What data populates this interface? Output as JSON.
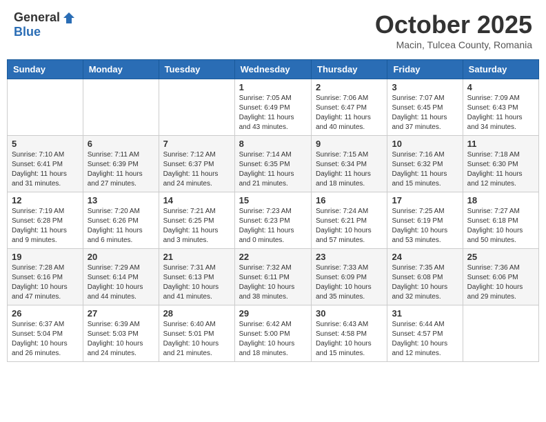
{
  "header": {
    "logo_general": "General",
    "logo_blue": "Blue",
    "month_title": "October 2025",
    "subtitle": "Macin, Tulcea County, Romania"
  },
  "weekdays": [
    "Sunday",
    "Monday",
    "Tuesday",
    "Wednesday",
    "Thursday",
    "Friday",
    "Saturday"
  ],
  "weeks": [
    [
      {
        "day": "",
        "info": ""
      },
      {
        "day": "",
        "info": ""
      },
      {
        "day": "",
        "info": ""
      },
      {
        "day": "1",
        "info": "Sunrise: 7:05 AM\nSunset: 6:49 PM\nDaylight: 11 hours\nand 43 minutes."
      },
      {
        "day": "2",
        "info": "Sunrise: 7:06 AM\nSunset: 6:47 PM\nDaylight: 11 hours\nand 40 minutes."
      },
      {
        "day": "3",
        "info": "Sunrise: 7:07 AM\nSunset: 6:45 PM\nDaylight: 11 hours\nand 37 minutes."
      },
      {
        "day": "4",
        "info": "Sunrise: 7:09 AM\nSunset: 6:43 PM\nDaylight: 11 hours\nand 34 minutes."
      }
    ],
    [
      {
        "day": "5",
        "info": "Sunrise: 7:10 AM\nSunset: 6:41 PM\nDaylight: 11 hours\nand 31 minutes."
      },
      {
        "day": "6",
        "info": "Sunrise: 7:11 AM\nSunset: 6:39 PM\nDaylight: 11 hours\nand 27 minutes."
      },
      {
        "day": "7",
        "info": "Sunrise: 7:12 AM\nSunset: 6:37 PM\nDaylight: 11 hours\nand 24 minutes."
      },
      {
        "day": "8",
        "info": "Sunrise: 7:14 AM\nSunset: 6:35 PM\nDaylight: 11 hours\nand 21 minutes."
      },
      {
        "day": "9",
        "info": "Sunrise: 7:15 AM\nSunset: 6:34 PM\nDaylight: 11 hours\nand 18 minutes."
      },
      {
        "day": "10",
        "info": "Sunrise: 7:16 AM\nSunset: 6:32 PM\nDaylight: 11 hours\nand 15 minutes."
      },
      {
        "day": "11",
        "info": "Sunrise: 7:18 AM\nSunset: 6:30 PM\nDaylight: 11 hours\nand 12 minutes."
      }
    ],
    [
      {
        "day": "12",
        "info": "Sunrise: 7:19 AM\nSunset: 6:28 PM\nDaylight: 11 hours\nand 9 minutes."
      },
      {
        "day": "13",
        "info": "Sunrise: 7:20 AM\nSunset: 6:26 PM\nDaylight: 11 hours\nand 6 minutes."
      },
      {
        "day": "14",
        "info": "Sunrise: 7:21 AM\nSunset: 6:25 PM\nDaylight: 11 hours\nand 3 minutes."
      },
      {
        "day": "15",
        "info": "Sunrise: 7:23 AM\nSunset: 6:23 PM\nDaylight: 11 hours\nand 0 minutes."
      },
      {
        "day": "16",
        "info": "Sunrise: 7:24 AM\nSunset: 6:21 PM\nDaylight: 10 hours\nand 57 minutes."
      },
      {
        "day": "17",
        "info": "Sunrise: 7:25 AM\nSunset: 6:19 PM\nDaylight: 10 hours\nand 53 minutes."
      },
      {
        "day": "18",
        "info": "Sunrise: 7:27 AM\nSunset: 6:18 PM\nDaylight: 10 hours\nand 50 minutes."
      }
    ],
    [
      {
        "day": "19",
        "info": "Sunrise: 7:28 AM\nSunset: 6:16 PM\nDaylight: 10 hours\nand 47 minutes."
      },
      {
        "day": "20",
        "info": "Sunrise: 7:29 AM\nSunset: 6:14 PM\nDaylight: 10 hours\nand 44 minutes."
      },
      {
        "day": "21",
        "info": "Sunrise: 7:31 AM\nSunset: 6:13 PM\nDaylight: 10 hours\nand 41 minutes."
      },
      {
        "day": "22",
        "info": "Sunrise: 7:32 AM\nSunset: 6:11 PM\nDaylight: 10 hours\nand 38 minutes."
      },
      {
        "day": "23",
        "info": "Sunrise: 7:33 AM\nSunset: 6:09 PM\nDaylight: 10 hours\nand 35 minutes."
      },
      {
        "day": "24",
        "info": "Sunrise: 7:35 AM\nSunset: 6:08 PM\nDaylight: 10 hours\nand 32 minutes."
      },
      {
        "day": "25",
        "info": "Sunrise: 7:36 AM\nSunset: 6:06 PM\nDaylight: 10 hours\nand 29 minutes."
      }
    ],
    [
      {
        "day": "26",
        "info": "Sunrise: 6:37 AM\nSunset: 5:04 PM\nDaylight: 10 hours\nand 26 minutes."
      },
      {
        "day": "27",
        "info": "Sunrise: 6:39 AM\nSunset: 5:03 PM\nDaylight: 10 hours\nand 24 minutes."
      },
      {
        "day": "28",
        "info": "Sunrise: 6:40 AM\nSunset: 5:01 PM\nDaylight: 10 hours\nand 21 minutes."
      },
      {
        "day": "29",
        "info": "Sunrise: 6:42 AM\nSunset: 5:00 PM\nDaylight: 10 hours\nand 18 minutes."
      },
      {
        "day": "30",
        "info": "Sunrise: 6:43 AM\nSunset: 4:58 PM\nDaylight: 10 hours\nand 15 minutes."
      },
      {
        "day": "31",
        "info": "Sunrise: 6:44 AM\nSunset: 4:57 PM\nDaylight: 10 hours\nand 12 minutes."
      },
      {
        "day": "",
        "info": ""
      }
    ]
  ]
}
